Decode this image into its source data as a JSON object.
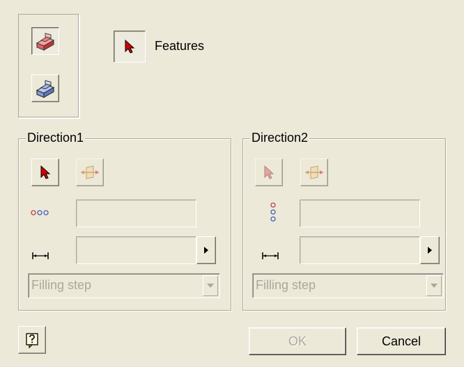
{
  "feature_selector": {
    "label": "Features"
  },
  "direction1": {
    "title": "Direction1",
    "step_placeholder": "Filling step"
  },
  "direction2": {
    "title": "Direction2",
    "step_placeholder": "Filling step"
  },
  "buttons": {
    "ok": "OK",
    "cancel": "Cancel"
  },
  "icons": {
    "solid_mode": "red-extrude-solid-icon",
    "surface_mode": "blue-extrude-surface-icon",
    "select": "red-arrow-cursor-icon",
    "direction": "direction-arrows-icon",
    "count": "dots-icon",
    "spacing": "dimension-icon",
    "help": "help-question-icon"
  },
  "colors": {
    "face": "#ece9d8",
    "accent_red": "#d40000"
  }
}
